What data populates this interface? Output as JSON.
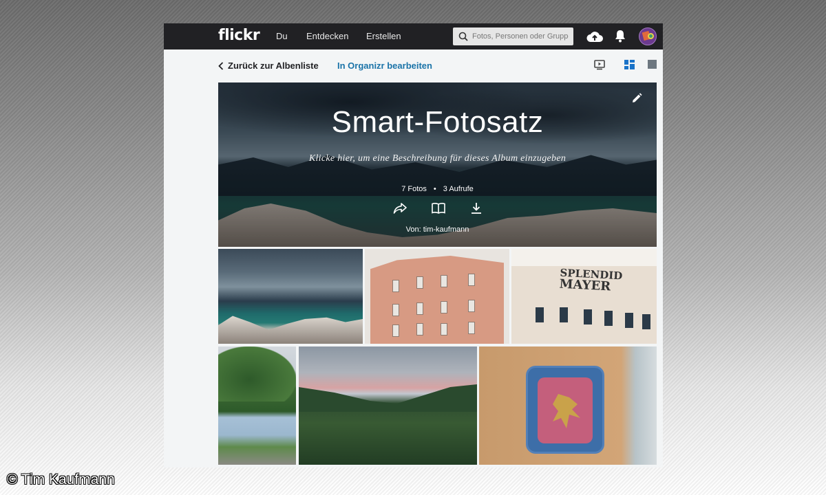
{
  "topbar": {
    "logo": "flickr",
    "nav": [
      "Du",
      "Entdecken",
      "Erstellen"
    ],
    "search_placeholder": "Fotos, Personen oder Gruppen"
  },
  "subbar": {
    "back_label": "Zurück zur Albenliste",
    "organizr_label": "In Organizr bearbeiten"
  },
  "album": {
    "title": "Smart-Fotosatz",
    "description": "Klicke hier, um eine Beschreibung für dieses Album einzugeben",
    "photos_count": "7 Fotos",
    "views": "3 Aufrufe",
    "owner": "Von: tim-kaufmann"
  },
  "photos": [
    {
      "name": "lake-mountains-rocks"
    },
    {
      "name": "pink-building-balconies"
    },
    {
      "name": "splendid-mayer-hotel"
    },
    {
      "name": "trees-buildings-promenade"
    },
    {
      "name": "green-valley-sunset"
    },
    {
      "name": "blue-tile-griffin"
    }
  ],
  "photo_texts": {
    "hotel_sign_line1": "SPLENDID",
    "hotel_sign_line2": "MAYER"
  },
  "colors": {
    "topbar_bg": "#212124",
    "link_blue": "#1a73a8",
    "page_bg": "#f3f5f6"
  },
  "watermark": "© Tim Kaufmann"
}
